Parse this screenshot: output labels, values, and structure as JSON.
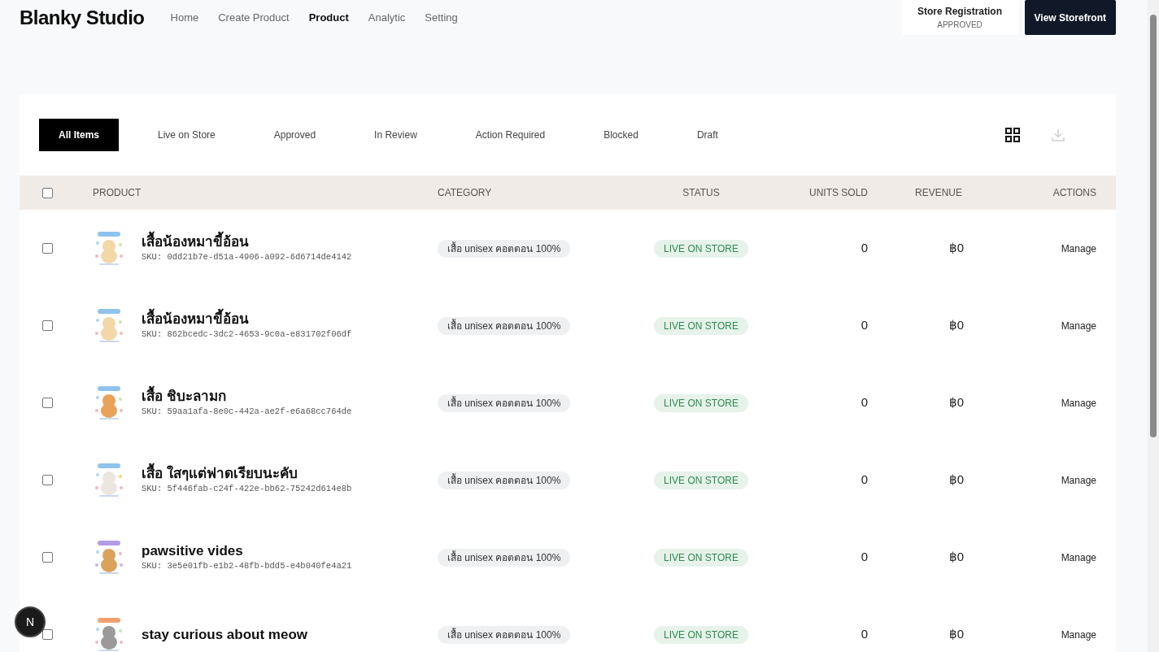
{
  "header": {
    "logo": "Blanky Studio",
    "nav": [
      {
        "label": "Home",
        "selected": false
      },
      {
        "label": "Create Product",
        "selected": false
      },
      {
        "label": "Product",
        "selected": true
      },
      {
        "label": "Analytic",
        "selected": false
      },
      {
        "label": "Setting",
        "selected": false
      }
    ],
    "registration": {
      "title": "Store Registration",
      "status": "APPROVED"
    },
    "storefront_button": "View Storefront"
  },
  "filters": [
    {
      "label": "All Items",
      "selected": true
    },
    {
      "label": "Live on Store",
      "selected": false
    },
    {
      "label": "Approved",
      "selected": false
    },
    {
      "label": "In Review",
      "selected": false
    },
    {
      "label": "Action Required",
      "selected": false
    },
    {
      "label": "Blocked",
      "selected": false
    },
    {
      "label": "Draft",
      "selected": false
    }
  ],
  "table": {
    "select_all_checked": false,
    "columns": [
      "PRODUCT",
      "CATEGORY",
      "STATUS",
      "UNITS SOLD",
      "REVENUE",
      "ACTIONS"
    ],
    "rows": [
      {
        "checked": false,
        "name": "เสื้อน้องหมาขี้อ้อน",
        "sku": "SKU: 0dd21b7e-d51a-4906-a092-6d6714de4142",
        "category": "เสื้อ unisex คอตตอน 100%",
        "status": "LIVE ON STORE",
        "units_sold": "0",
        "revenue": "฿0",
        "action": "Manage"
      },
      {
        "checked": false,
        "name": "เสื้อน้องหมาขี้อ้อน",
        "sku": "SKU: 862bcedc-3dc2-4653-9c0a-e831702f06df",
        "category": "เสื้อ unisex คอตตอน 100%",
        "status": "LIVE ON STORE",
        "units_sold": "0",
        "revenue": "฿0",
        "action": "Manage"
      },
      {
        "checked": false,
        "name": "เสื้อ ชิบะลามก",
        "sku": "SKU: 59aa1afa-8e0c-442a-ae2f-e6a68cc764de",
        "category": "เสื้อ unisex คอตตอน 100%",
        "status": "LIVE ON STORE",
        "units_sold": "0",
        "revenue": "฿0",
        "action": "Manage"
      },
      {
        "checked": false,
        "name": "เสื้อ ใสๆแต่ฟาดเรียบนะคับ",
        "sku": "SKU: 5f446fab-c24f-422e-bb62-75242d614e8b",
        "category": "เสื้อ unisex คอตตอน 100%",
        "status": "LIVE ON STORE",
        "units_sold": "0",
        "revenue": "฿0",
        "action": "Manage"
      },
      {
        "checked": false,
        "name": "pawsitive vides",
        "sku": "SKU: 3e5e01fb-e1b2-48fb-bdd5-e4b040fe4a21",
        "category": "เสื้อ unisex คอตตอน 100%",
        "status": "LIVE ON STORE",
        "units_sold": "0",
        "revenue": "฿0",
        "action": "Manage"
      },
      {
        "checked": false,
        "name": "stay curious about meow",
        "category": "เสื้อ unisex คอตตอน 100%",
        "status": "LIVE ON STORE",
        "units_sold": "0",
        "revenue": "฿0",
        "action": "Manage"
      }
    ]
  },
  "dev_badge": "N"
}
